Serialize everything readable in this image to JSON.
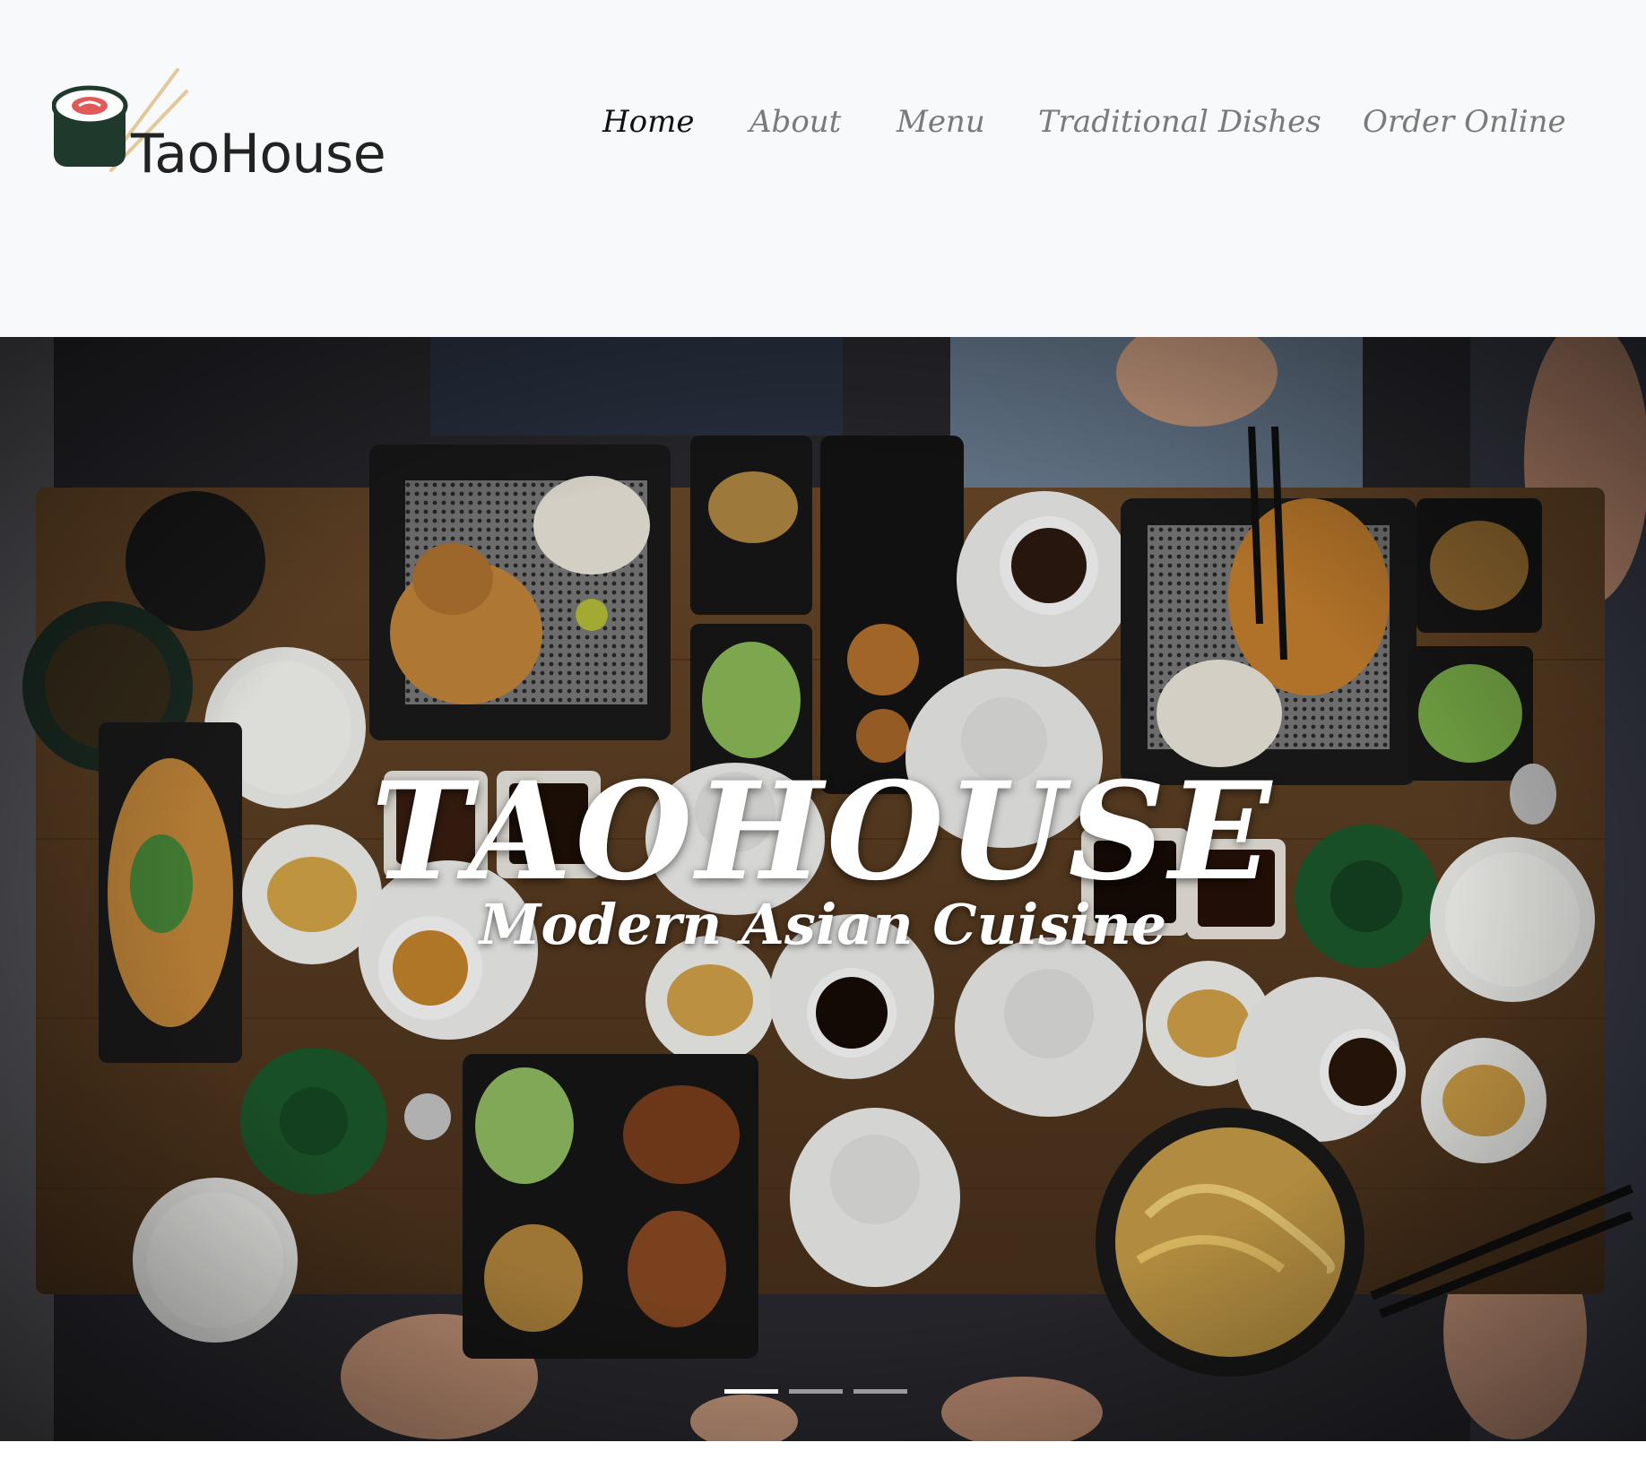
{
  "brand": {
    "name": "TaoHouse",
    "logo_icon": "sushi-roll-with-chopsticks-icon"
  },
  "nav": {
    "items": [
      {
        "label": "Home",
        "active": true
      },
      {
        "label": "About",
        "active": false
      },
      {
        "label": "Menu",
        "active": false
      },
      {
        "label": "Traditional Dishes",
        "active": false
      },
      {
        "label": "Order Online",
        "active": false
      }
    ]
  },
  "hero": {
    "title": "TAOHOUSE",
    "subtitle": "Modern Asian Cuisine",
    "slide_count": 3,
    "active_slide": 1
  },
  "colors": {
    "header_bg": "#f8f9fa",
    "nav_active": "#111111",
    "nav_inactive": "#7a7a7a",
    "hero_text": "#ffffff",
    "logo_dark": "#1f3a2c",
    "logo_accent": "#e05a5a"
  }
}
